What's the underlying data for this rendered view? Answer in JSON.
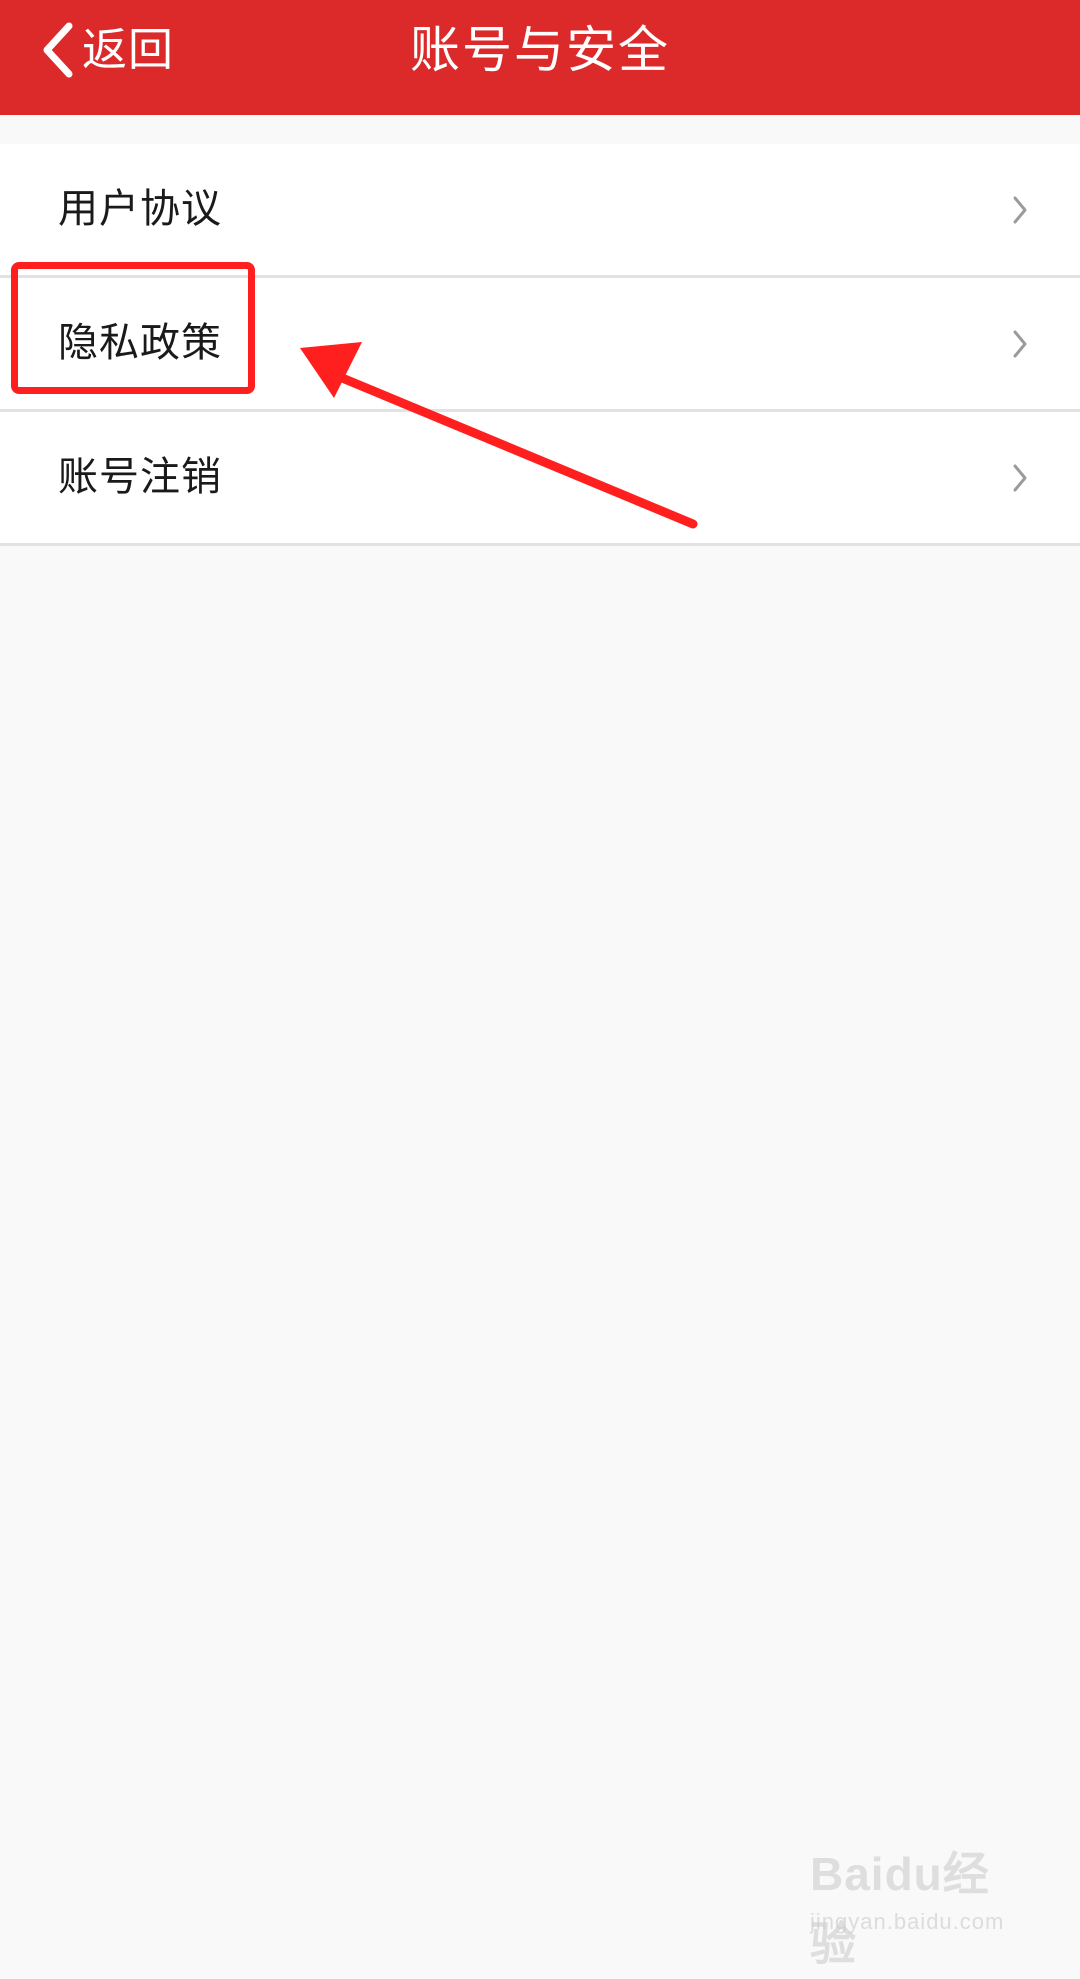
{
  "header": {
    "back_label": "返回",
    "title": "账号与安全",
    "background_color": "#dc2a2b"
  },
  "menu": {
    "items": [
      {
        "label": "用户协议",
        "icon": "chevron-right-icon"
      },
      {
        "label": "隐私政策",
        "icon": "chevron-right-icon"
      },
      {
        "label": "账号注销",
        "icon": "chevron-right-icon"
      }
    ]
  },
  "annotation": {
    "highlight_color": "#ff1f1f",
    "highlighted_item": "隐私政策"
  },
  "watermark": {
    "logo": "Baidu经验",
    "url": "jingyan.baidu.com"
  }
}
